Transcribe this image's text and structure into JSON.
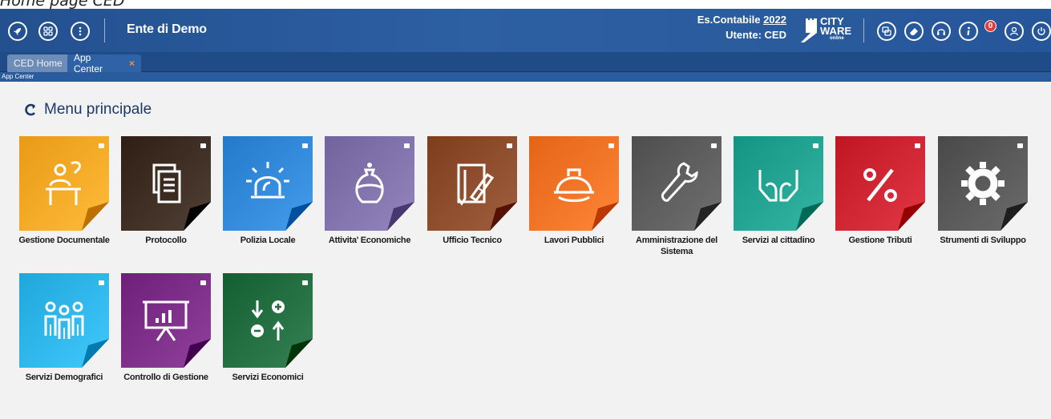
{
  "caption": "Home page CED",
  "header": {
    "app_title": "Ente di Demo",
    "year_label": "Es.Contabile ",
    "year_value": "2022",
    "user_label": "Utente: CED",
    "logo_line1": "CITY",
    "logo_line2": "WARE",
    "logo_line3": "online",
    "notification_count": "0"
  },
  "tabs": [
    {
      "label": "CED Home"
    },
    {
      "label": "App Center",
      "close": "×"
    }
  ],
  "breadcrumb": "App Center",
  "main": {
    "section_title": "Menu principale"
  },
  "apps": [
    {
      "label": "Gestione Documentale",
      "icon": "desk-person-icon",
      "color": "#f4a623"
    },
    {
      "label": "Protocollo",
      "icon": "documents-icon",
      "color": "#3a2a20"
    },
    {
      "label": "Polizia Locale",
      "icon": "siren-icon",
      "color": "#2f86d6"
    },
    {
      "label": "Attivita' Economiche",
      "icon": "money-bag-icon",
      "color": "#7e6fa8"
    },
    {
      "label": "Ufficio Tecnico",
      "icon": "ruler-pencil-icon",
      "color": "#8a4a2a"
    },
    {
      "label": "Lavori Pubblici",
      "icon": "helmet-icon",
      "color": "#f07022"
    },
    {
      "label": "Amministrazione del Sistema",
      "icon": "wrench-icon",
      "color": "#5a5a5a"
    },
    {
      "label": "Servizi al cittadino",
      "icon": "hands-icon",
      "color": "#1fa08e"
    },
    {
      "label": "Gestione Tributi",
      "icon": "percent-icon",
      "color": "#cc2230"
    },
    {
      "label": "Strumenti di Sviluppo",
      "icon": "gear-icon",
      "color": "#555555"
    },
    {
      "label": "Servizi Demografici",
      "icon": "people-icon",
      "color": "#2bb2e6"
    },
    {
      "label": "Controllo di Gestione",
      "icon": "presentation-chart-icon",
      "color": "#7a2b86"
    },
    {
      "label": "Servizi Economici",
      "icon": "plus-minus-arrows-icon",
      "color": "#1f6b3e"
    }
  ]
}
